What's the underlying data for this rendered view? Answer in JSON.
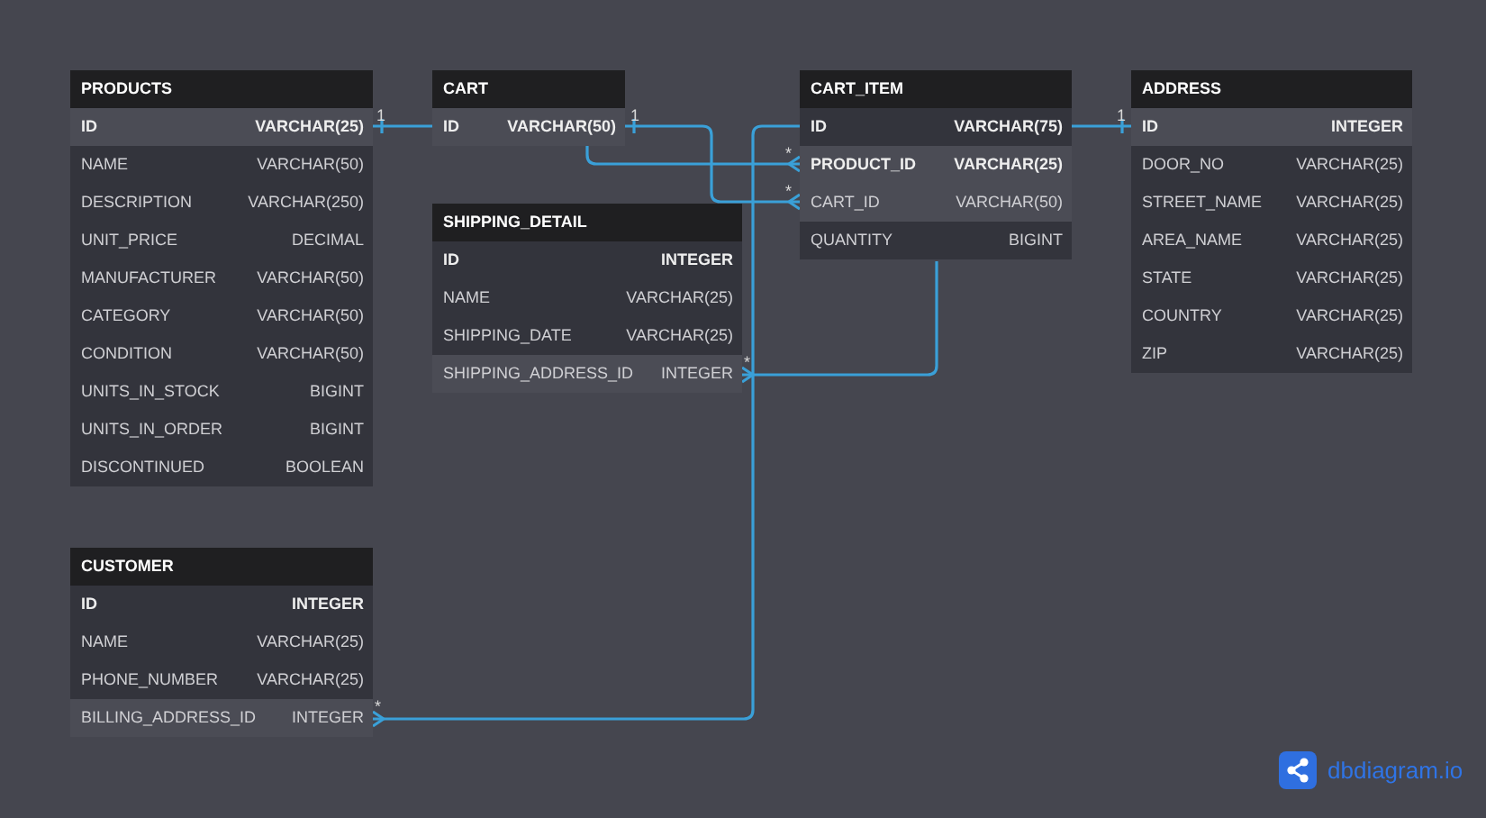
{
  "tables": [
    {
      "name": "PRODUCTS",
      "fields": [
        {
          "name": "ID",
          "type": "VARCHAR(25)",
          "key": true,
          "highlighted": true
        },
        {
          "name": "NAME",
          "type": "VARCHAR(50)",
          "key": false,
          "highlighted": false
        },
        {
          "name": "DESCRIPTION",
          "type": "VARCHAR(250)",
          "key": false,
          "highlighted": false
        },
        {
          "name": "UNIT_PRICE",
          "type": "DECIMAL",
          "key": false,
          "highlighted": false
        },
        {
          "name": "MANUFACTURER",
          "type": "VARCHAR(50)",
          "key": false,
          "highlighted": false
        },
        {
          "name": "CATEGORY",
          "type": "VARCHAR(50)",
          "key": false,
          "highlighted": false
        },
        {
          "name": "CONDITION",
          "type": "VARCHAR(50)",
          "key": false,
          "highlighted": false
        },
        {
          "name": "UNITS_IN_STOCK",
          "type": "BIGINT",
          "key": false,
          "highlighted": false
        },
        {
          "name": "UNITS_IN_ORDER",
          "type": "BIGINT",
          "key": false,
          "highlighted": false
        },
        {
          "name": "DISCONTINUED",
          "type": "BOOLEAN",
          "key": false,
          "highlighted": false
        }
      ]
    },
    {
      "name": "CART",
      "fields": [
        {
          "name": "ID",
          "type": "VARCHAR(50)",
          "key": true,
          "highlighted": true
        }
      ]
    },
    {
      "name": "SHIPPING_DETAIL",
      "fields": [
        {
          "name": "ID",
          "type": "INTEGER",
          "key": true,
          "highlighted": false
        },
        {
          "name": "NAME",
          "type": "VARCHAR(25)",
          "key": false,
          "highlighted": false
        },
        {
          "name": "SHIPPING_DATE",
          "type": "VARCHAR(25)",
          "key": false,
          "highlighted": false
        },
        {
          "name": "SHIPPING_ADDRESS_ID",
          "type": "INTEGER",
          "key": false,
          "highlighted": true
        }
      ]
    },
    {
      "name": "CART_ITEM",
      "fields": [
        {
          "name": "ID",
          "type": "VARCHAR(75)",
          "key": true,
          "highlighted": false
        },
        {
          "name": "PRODUCT_ID",
          "type": "VARCHAR(25)",
          "key": true,
          "highlighted": true
        },
        {
          "name": "CART_ID",
          "type": "VARCHAR(50)",
          "key": false,
          "highlighted": true
        },
        {
          "name": "QUANTITY",
          "type": "BIGINT",
          "key": false,
          "highlighted": false
        }
      ]
    },
    {
      "name": "ADDRESS",
      "fields": [
        {
          "name": "ID",
          "type": "INTEGER",
          "key": true,
          "highlighted": true
        },
        {
          "name": "DOOR_NO",
          "type": "VARCHAR(25)",
          "key": false,
          "highlighted": false
        },
        {
          "name": "STREET_NAME",
          "type": "VARCHAR(25)",
          "key": false,
          "highlighted": false
        },
        {
          "name": "AREA_NAME",
          "type": "VARCHAR(25)",
          "key": false,
          "highlighted": false
        },
        {
          "name": "STATE",
          "type": "VARCHAR(25)",
          "key": false,
          "highlighted": false
        },
        {
          "name": "COUNTRY",
          "type": "VARCHAR(25)",
          "key": false,
          "highlighted": false
        },
        {
          "name": "ZIP",
          "type": "VARCHAR(25)",
          "key": false,
          "highlighted": false
        }
      ]
    },
    {
      "name": "CUSTOMER",
      "fields": [
        {
          "name": "ID",
          "type": "INTEGER",
          "key": true,
          "highlighted": false
        },
        {
          "name": "NAME",
          "type": "VARCHAR(25)",
          "key": false,
          "highlighted": false
        },
        {
          "name": "PHONE_NUMBER",
          "type": "VARCHAR(25)",
          "key": false,
          "highlighted": false
        },
        {
          "name": "BILLING_ADDRESS_ID",
          "type": "INTEGER",
          "key": false,
          "highlighted": true
        }
      ]
    }
  ],
  "relations": [
    {
      "start_label": "1",
      "end_label": "*"
    },
    {
      "start_label": "1",
      "end_label": "*"
    },
    {
      "end_label": "*"
    },
    {
      "end_label": "*"
    },
    {
      "end_label": "1"
    }
  ],
  "brand": {
    "name": "dbdiagram.io"
  }
}
